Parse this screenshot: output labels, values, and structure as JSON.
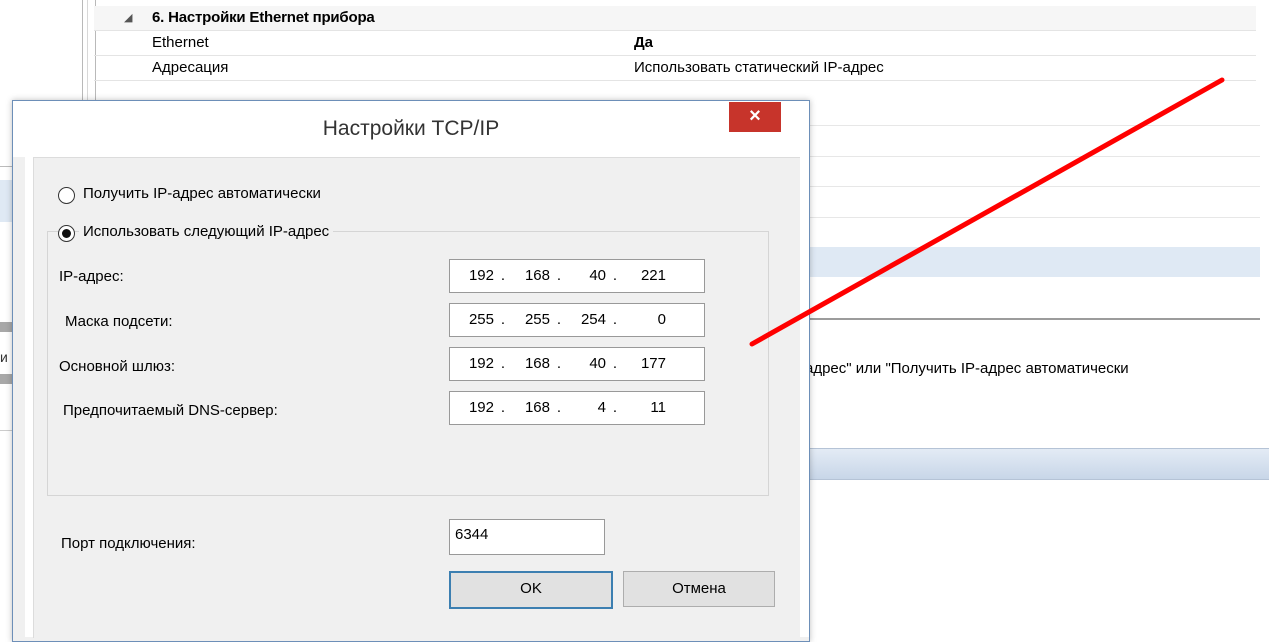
{
  "background": {
    "section_title": "6. Настройки Ethernet прибора",
    "rows": [
      {
        "name": "Ethernet",
        "value": "Да"
      },
      {
        "name": "Адресация",
        "value": "Использовать статический IP-адрес"
      }
    ],
    "description_fragment": "-адрес\" или \"Получить IP-адрес автоматически",
    "left_fragment": "и"
  },
  "dialog": {
    "title": "Настройки TCP/IP",
    "close_symbol": "×",
    "radio_auto": "Получить IP-адрес автоматически",
    "radio_static": "Использовать следующий IP-адрес",
    "fields": {
      "ip": {
        "label": "IP-адрес:",
        "octets": [
          "192",
          "168",
          "40",
          "221"
        ]
      },
      "mask": {
        "label": "Маска подсети:",
        "octets": [
          "255",
          "255",
          "254",
          "0"
        ]
      },
      "gateway": {
        "label": "Основной шлюз:",
        "octets": [
          "192",
          "168",
          "40",
          "177"
        ]
      },
      "dns": {
        "label": "Предпочитаемый DNS-сервер:",
        "octets": [
          "192",
          "168",
          "4",
          "11"
        ]
      }
    },
    "port_label": "Порт подключения:",
    "port_value": "6344",
    "ok_label": "OK",
    "cancel_label": "Отмена"
  },
  "colors": {
    "annotation_line": "#ff0000",
    "close_button": "#c7342b",
    "selection_band": "#dfe9f4"
  }
}
